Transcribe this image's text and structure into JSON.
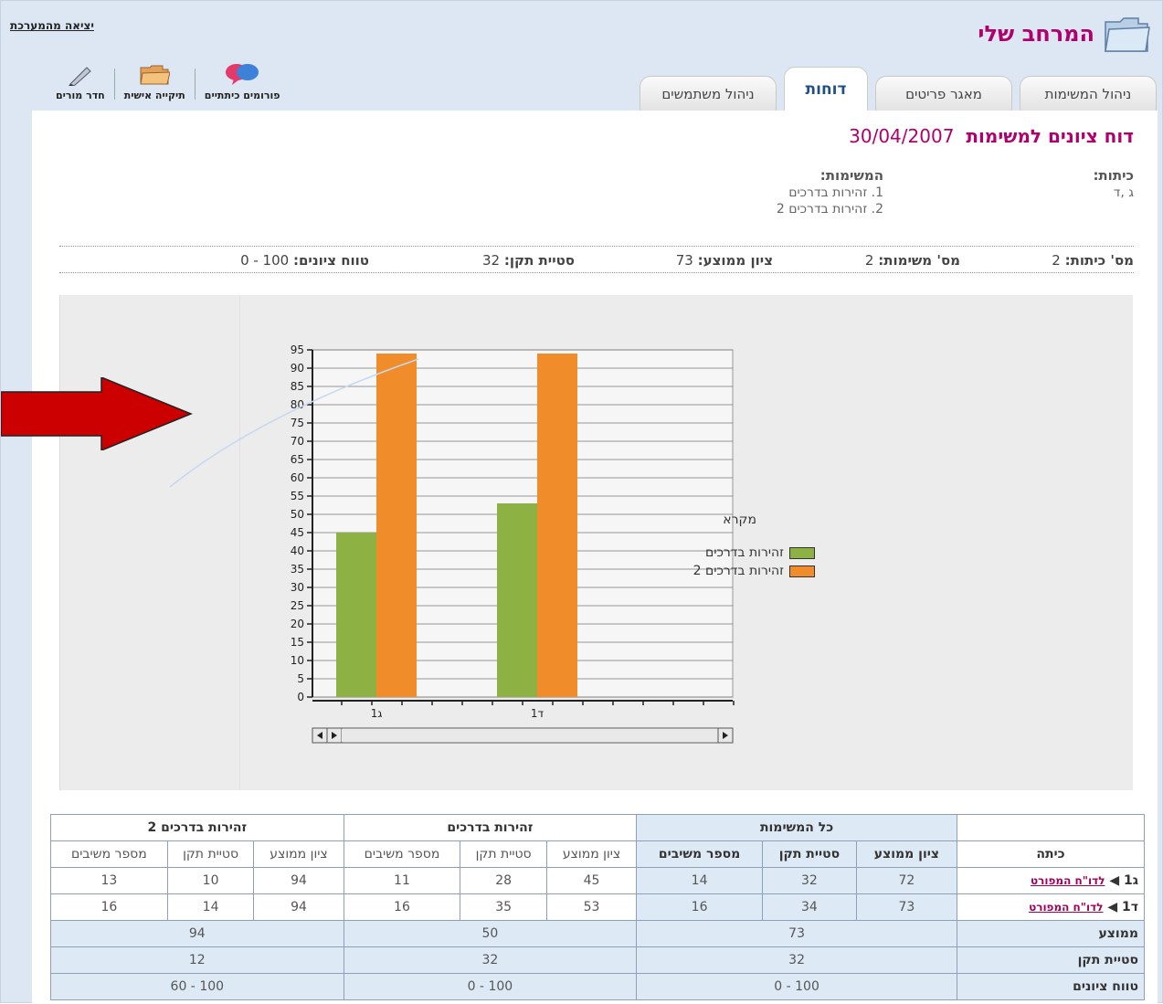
{
  "header": {
    "title": "המרחב שלי",
    "logout": "יציאה מהמערכת",
    "utils": [
      {
        "label": "חדר מורים",
        "icon": "pen-icon"
      },
      {
        "label": "תיקייה אישית",
        "icon": "folder-icon"
      },
      {
        "label": "פורומים כיתתיים",
        "icon": "chat-bubbles-icon"
      }
    ],
    "tabs": [
      {
        "label": "ניהול המשימות",
        "active": false
      },
      {
        "label": "מאגר פריטים",
        "active": false
      },
      {
        "label": "דוחות",
        "active": true
      },
      {
        "label": "ניהול משתמשים",
        "active": false
      }
    ]
  },
  "report": {
    "title": "דוח ציונים למשימות",
    "date": "30/04/2007",
    "classes_label": "כיתות:",
    "classes_value": "ג ,ד",
    "tasks_label": "המשימות:",
    "tasks": [
      "1. זהירות בדרכים",
      "2. זהירות בדרכים 2"
    ],
    "stats": {
      "num_classes": {
        "label": "מס' כיתות:",
        "value": "2"
      },
      "num_tasks": {
        "label": "מס' משימות:",
        "value": "2"
      },
      "average": {
        "label": "ציון ממוצע:",
        "value": "73"
      },
      "std_dev": {
        "label": "סטיית תקן:",
        "value": "32"
      },
      "range": {
        "label": "טווח ציונים:",
        "value": "0 - 100"
      }
    }
  },
  "chart_data": {
    "type": "bar",
    "categories": [
      "ג1",
      "ד1"
    ],
    "series": [
      {
        "name": "זהירות בדרכים",
        "values": [
          45,
          53
        ],
        "color": "#8db243"
      },
      {
        "name": "זהירות בדרכים 2",
        "values": [
          94,
          94
        ],
        "color": "#f08c2a"
      }
    ],
    "ylim": [
      0,
      95
    ],
    "yticks": [
      "95",
      "90",
      "85",
      "80",
      "75",
      "70",
      "65",
      "60",
      "55",
      "50",
      "45",
      "40",
      "35",
      "30",
      "25",
      "20",
      "15",
      "10",
      "5",
      "0"
    ],
    "legend_title": "מקרא",
    "legend_position": "right",
    "grid": true
  },
  "table": {
    "group_headers": [
      "כל המשימות",
      "זהירות בדרכים",
      "זהירות בדרכים 2"
    ],
    "class_header": "כיתה",
    "sub_headers": [
      "ציון ממוצע",
      "סטיית תקן",
      "מספר משיבים"
    ],
    "sport_link": "לדו\"ח המפורט",
    "rows": [
      {
        "class": "ג1",
        "values": [
          "72",
          "32",
          "14",
          "45",
          "28",
          "11",
          "94",
          "10",
          "13"
        ]
      },
      {
        "class": "ד1",
        "values": [
          "73",
          "34",
          "16",
          "53",
          "35",
          "16",
          "94",
          "14",
          "16"
        ]
      }
    ],
    "summary": [
      {
        "label": "ממוצע",
        "values": [
          "73",
          "50",
          "94"
        ]
      },
      {
        "label": "סטיית תקן",
        "values": [
          "32",
          "32",
          "12"
        ]
      },
      {
        "label": "טווח ציונים",
        "values": [
          "0 - 100",
          "0 - 100",
          "60 - 100"
        ]
      }
    ]
  },
  "colors": {
    "brand": "#b0006c",
    "tab_active": "#1e4f86",
    "arrow": "#cc0000"
  }
}
